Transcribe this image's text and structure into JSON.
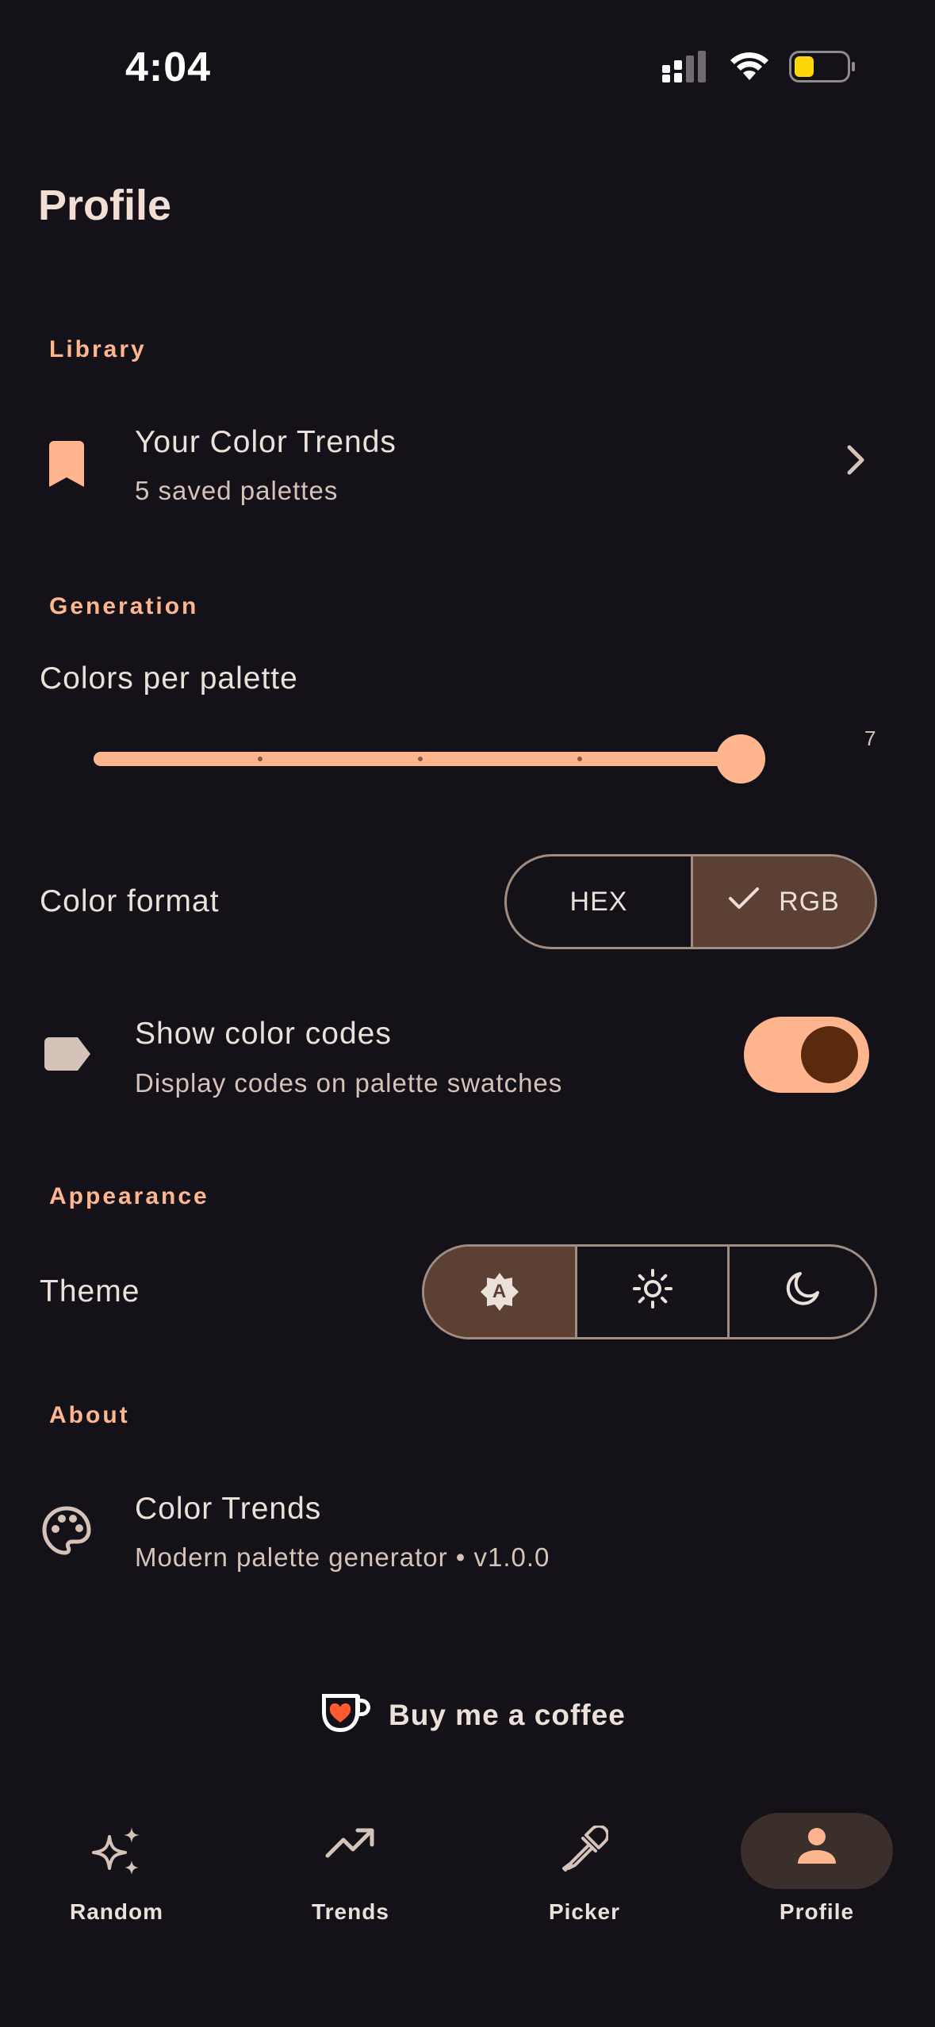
{
  "status_bar": {
    "time": "4:04",
    "battery_color": "#FFD60A"
  },
  "page": {
    "title": "Profile"
  },
  "library": {
    "section_label": "Library",
    "item": {
      "title": "Your Color Trends",
      "subtitle": "5 saved palettes",
      "icon": "bookmark-icon"
    }
  },
  "generation": {
    "section_label": "Generation",
    "colors_per_palette": {
      "label": "Colors per palette",
      "value": "7",
      "min": 3,
      "max": 7,
      "current": 7
    },
    "color_format": {
      "label": "Color format",
      "options": [
        "HEX",
        "RGB"
      ],
      "selected": "RGB"
    },
    "show_codes": {
      "title": "Show color codes",
      "subtitle": "Display codes on palette swatches",
      "enabled": true,
      "icon": "label-icon"
    }
  },
  "appearance": {
    "section_label": "Appearance",
    "theme": {
      "label": "Theme",
      "options": [
        "auto",
        "light",
        "dark"
      ],
      "selected": "auto",
      "auto_glyph": "A"
    }
  },
  "about": {
    "section_label": "About",
    "app": {
      "title": "Color Trends",
      "subtitle": "Modern palette generator • v1.0.0",
      "icon": "palette-icon"
    }
  },
  "coffee": {
    "label": "Buy me a coffee"
  },
  "nav": {
    "items": [
      {
        "label": "Random",
        "icon": "sparkles-icon"
      },
      {
        "label": "Trends",
        "icon": "trending-up-icon"
      },
      {
        "label": "Picker",
        "icon": "eyedropper-icon"
      },
      {
        "label": "Profile",
        "icon": "person-icon"
      }
    ],
    "active": "Profile"
  },
  "colors": {
    "background": "#141218",
    "accent": "#FFB68F",
    "selected_segment": "#5C4033",
    "toggle_knob": "#5A2A0E"
  }
}
